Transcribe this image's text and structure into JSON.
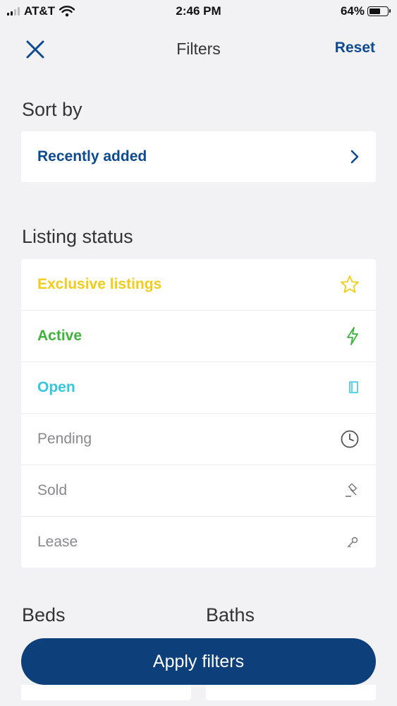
{
  "status_bar": {
    "carrier": "AT&T",
    "time": "2:46 PM",
    "battery_percent": "64%",
    "battery_level": 0.64
  },
  "nav": {
    "title": "Filters",
    "reset_label": "Reset",
    "close_icon": "close-icon"
  },
  "sort": {
    "title": "Sort by",
    "selected": "Recently added",
    "chevron_icon": "chevron-right-icon"
  },
  "listing_status": {
    "title": "Listing status",
    "items": [
      {
        "label": "Exclusive listings",
        "color": "#f2cc18",
        "icon": "star-icon"
      },
      {
        "label": "Active",
        "color": "#3fb33b",
        "icon": "lightning-icon"
      },
      {
        "label": "Open",
        "color": "#36c7e0",
        "icon": "door-icon"
      },
      {
        "label": "Pending",
        "color": "#8a8a8e",
        "icon": "clock-icon"
      },
      {
        "label": "Sold",
        "color": "#8a8a8e",
        "icon": "gavel-icon"
      },
      {
        "label": "Lease",
        "color": "#8a8a8e",
        "icon": "key-icon"
      }
    ]
  },
  "beds": {
    "title": "Beds"
  },
  "baths": {
    "title": "Baths"
  },
  "apply_label": "Apply filters",
  "colors": {
    "accent": "#0d4a8f",
    "apply_button": "#0d3f7a",
    "background": "#f2f2f4"
  }
}
